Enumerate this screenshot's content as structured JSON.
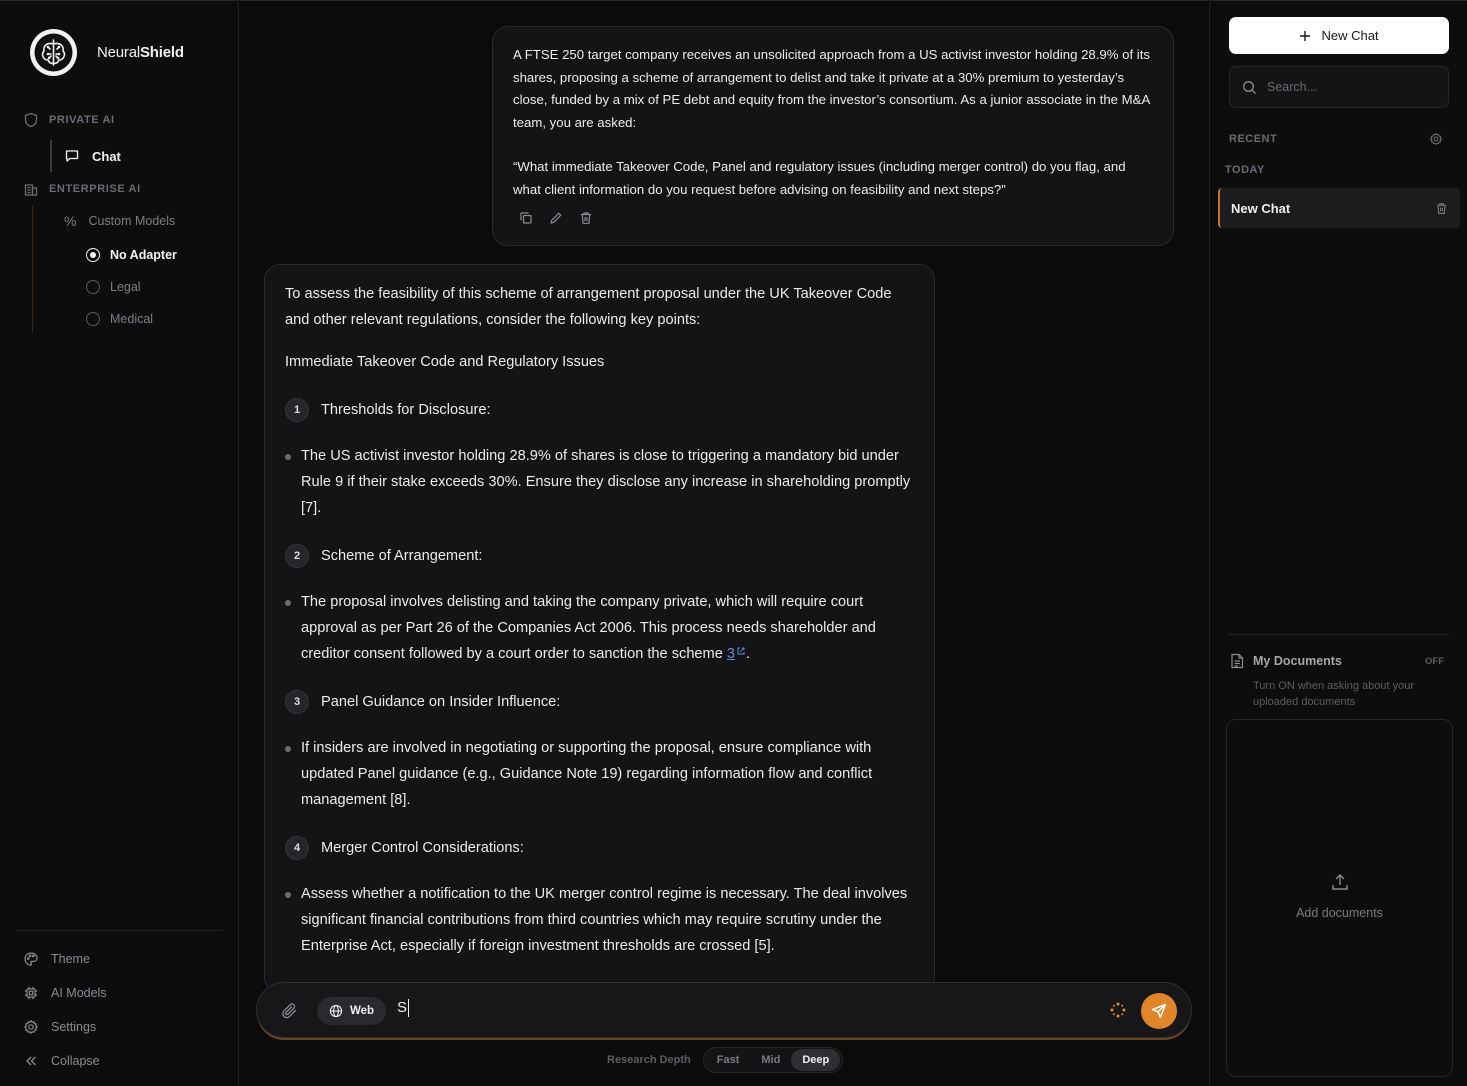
{
  "brand": {
    "prefix": "Neural",
    "suffix": "Shield"
  },
  "sidebar": {
    "private_label": "PRIVATE AI",
    "chat_label": "Chat",
    "enterprise_label": "ENTERPRISE AI",
    "custom_models_label": "Custom Models",
    "adapters": [
      {
        "label": "No Adapter",
        "selected": true
      },
      {
        "label": "Legal",
        "selected": false
      },
      {
        "label": "Medical",
        "selected": false
      }
    ],
    "footer": [
      {
        "label": "Theme",
        "icon": "palette-icon"
      },
      {
        "label": "AI Models",
        "icon": "chip-icon"
      },
      {
        "label": "Settings",
        "icon": "gear-icon"
      },
      {
        "label": "Collapse",
        "icon": "double-chevron-left-icon"
      }
    ]
  },
  "conversation": {
    "user_message": {
      "paragraph1": "A FTSE 250 target company receives an unsolicited approach from a US activist investor holding 28.9% of its shares, proposing a scheme of arrangement to delist and take it private at a 30% premium to yesterday’s close, funded by a mix of PE debt and equity from the investor’s consortium. As a junior associate in the M&A team, you are asked:",
      "paragraph2": "“What immediate Takeover Code, Panel and regulatory issues (including merger control) do you flag, and what client information do you request before advising on feasibility and next steps?”"
    },
    "assistant_message": {
      "intro": "To assess the feasibility of this scheme of arrangement proposal under the UK Takeover Code and other relevant regulations, consider the following key points:",
      "heading": "Immediate Takeover Code and Regulatory Issues",
      "items": [
        {
          "num": "1",
          "title": "Thresholds for Disclosure:",
          "bullet": "The US activist investor holding 28.9% of shares is close to triggering a mandatory bid under Rule 9 if their stake exceeds 30%. Ensure they disclose any increase in shareholding promptly [7]."
        },
        {
          "num": "2",
          "title": "Scheme of Arrangement:",
          "bullet": "The proposal involves delisting and taking the company private, which will require court approval as per Part 26 of the Companies Act 2006. This process needs shareholder and creditor consent followed by a court order to sanction the scheme",
          "cite": "3",
          "tail": "."
        },
        {
          "num": "3",
          "title": "Panel Guidance on Insider Influence:",
          "bullet": "If insiders are involved in negotiating or supporting the proposal, ensure compliance with updated Panel guidance (e.g., Guidance Note 19) regarding information flow and conflict management [8]."
        },
        {
          "num": "4",
          "title": "Merger Control Considerations:",
          "bullet": "Assess whether a notification to the UK merger control regime is necessary. The deal involves significant financial contributions from third countries which may require scrutiny under the Enterprise Act, especially if foreign investment thresholds are crossed [5]."
        }
      ]
    }
  },
  "composer": {
    "web_label": "Web",
    "typed_text": "S",
    "depth_label": "Research Depth",
    "depth_options": [
      "Fast",
      "Mid",
      "Deep"
    ],
    "depth_selected": "Deep",
    "accent_color": "#e0852a"
  },
  "right_panel": {
    "new_chat_label": "New Chat",
    "search_placeholder": "Search...",
    "recent_label": "RECENT",
    "today_label": "TODAY",
    "chats": [
      {
        "title": "New Chat",
        "active": true
      }
    ],
    "documents": {
      "title": "My Documents",
      "status": "OFF",
      "hint": "Turn ON when asking about your uploaded documents",
      "add_label": "Add documents"
    }
  }
}
